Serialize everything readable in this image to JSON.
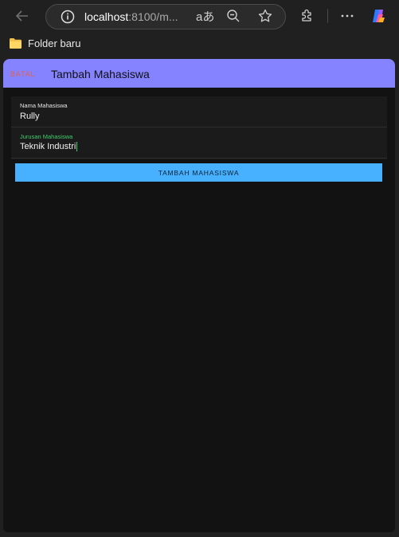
{
  "browser": {
    "url_host": "localhost",
    "url_rest": ":8100/m...",
    "translate_glyph": "aあ"
  },
  "bookmarks": {
    "items": [
      {
        "label": "Folder baru",
        "icon": "folder-icon"
      }
    ]
  },
  "app": {
    "header": {
      "cancel_label": "BATAL",
      "title": "Tambah Mahasiswa",
      "color": "#8583ff"
    },
    "form": {
      "name_label": "Nama Mahasiswa",
      "name_value": "Rully",
      "major_label": "Jurusan Mahasiswa",
      "major_value": "Teknik Industri",
      "focus_color": "#3fcf6a"
    },
    "submit_label": "TAMBAH MAHASISWA",
    "submit_color": "#47b0ff"
  }
}
